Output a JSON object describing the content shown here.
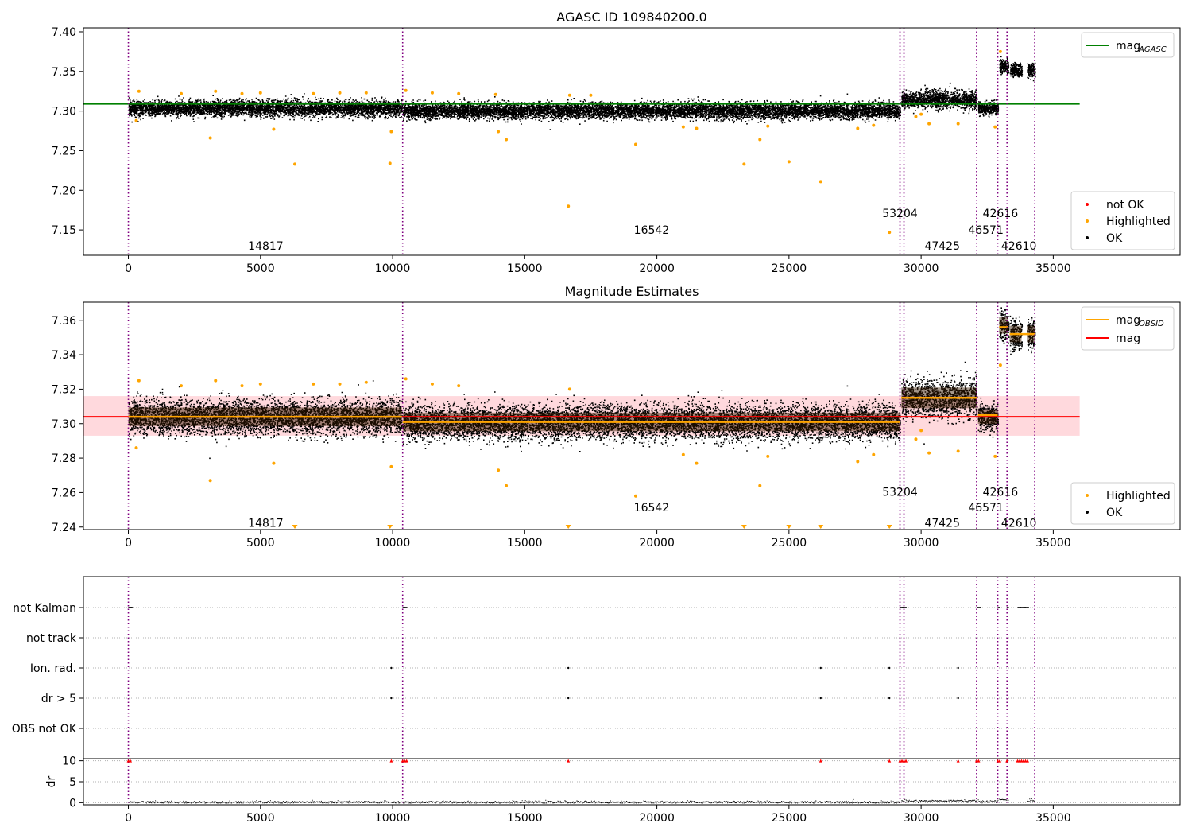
{
  "figure": {
    "panel1": {
      "title": "AGASC ID 109840200.0"
    },
    "panel2": {
      "title": "Magnitude Estimates"
    },
    "panel3": {
      "ylabel_dr": "dr"
    }
  },
  "chart_data": [
    {
      "type": "scatter",
      "panel": "AGASC",
      "title": "AGASC ID 109840200.0",
      "xlim": [
        -1700,
        39800
      ],
      "ylim": [
        7.118,
        7.405
      ],
      "xticks": [
        0,
        5000,
        10000,
        15000,
        20000,
        25000,
        30000,
        35000
      ],
      "yticks": [
        7.15,
        7.2,
        7.25,
        7.3,
        7.35,
        7.4
      ],
      "ytick_labels": [
        "7.15",
        "7.20",
        "7.25",
        "7.30",
        "7.35",
        "7.40"
      ],
      "legend_top": {
        "location": "upper right",
        "entries": [
          {
            "label_main": "mag",
            "label_sub": "AGASC",
            "color": "#008000",
            "kind": "line"
          }
        ]
      },
      "legend_bottom": {
        "location": "lower right",
        "entries": [
          {
            "label": "not OK",
            "color": "#ff0000",
            "kind": "dot"
          },
          {
            "label": "Highlighted",
            "color": "#ffa500",
            "kind": "dot"
          },
          {
            "label": "OK",
            "color": "#000000",
            "kind": "dot"
          }
        ]
      },
      "mag_agasc": {
        "value": 7.309,
        "x_range": [
          -1700,
          36000
        ],
        "color": "#008000"
      },
      "ok_segments": [
        {
          "x0": 0,
          "x1": 10350,
          "center": 7.304,
          "spread": 0.009
        },
        {
          "x0": 10380,
          "x1": 29200,
          "center": 7.301,
          "spread": 0.009
        },
        {
          "x0": 29250,
          "x1": 32100,
          "center": 7.315,
          "spread": 0.01
        },
        {
          "x0": 32150,
          "x1": 32900,
          "center": 7.304,
          "spread": 0.007
        },
        {
          "x0": 32950,
          "x1": 33300,
          "center": 7.357,
          "spread": 0.008
        },
        {
          "x0": 33350,
          "x1": 33800,
          "center": 7.352,
          "spread": 0.008
        },
        {
          "x0": 34000,
          "x1": 34300,
          "center": 7.352,
          "spread": 0.008
        }
      ],
      "highlighted": [
        [
          3100,
          7.266
        ],
        [
          6300,
          7.233
        ],
        [
          5500,
          7.277
        ],
        [
          9900,
          7.234
        ],
        [
          9950,
          7.274
        ],
        [
          14300,
          7.264
        ],
        [
          14000,
          7.274
        ],
        [
          16650,
          7.18
        ],
        [
          19200,
          7.258
        ],
        [
          23300,
          7.233
        ],
        [
          23900,
          7.264
        ],
        [
          25000,
          7.236
        ],
        [
          26200,
          7.211
        ],
        [
          28800,
          7.147
        ],
        [
          30300,
          7.284
        ],
        [
          31400,
          7.284
        ],
        [
          32800,
          7.28
        ],
        [
          33000,
          7.375
        ],
        [
          300,
          7.288
        ],
        [
          400,
          7.325
        ],
        [
          2000,
          7.322
        ],
        [
          3300,
          7.325
        ],
        [
          4300,
          7.322
        ],
        [
          5000,
          7.323
        ],
        [
          7000,
          7.322
        ],
        [
          8000,
          7.323
        ],
        [
          9000,
          7.323
        ],
        [
          10500,
          7.326
        ],
        [
          11500,
          7.323
        ],
        [
          12500,
          7.322
        ],
        [
          13900,
          7.321
        ],
        [
          16700,
          7.32
        ],
        [
          17500,
          7.32
        ],
        [
          21000,
          7.28
        ],
        [
          21500,
          7.278
        ],
        [
          24200,
          7.281
        ],
        [
          27600,
          7.278
        ],
        [
          28200,
          7.282
        ],
        [
          29800,
          7.293
        ],
        [
          30000,
          7.296
        ]
      ],
      "obsid_lines": [
        0,
        10380,
        29200,
        29350,
        32100,
        32900,
        33250,
        34300
      ],
      "obsid_labels": [
        {
          "text": "14817",
          "x": 5200,
          "y": 7.13
        },
        {
          "text": "16542",
          "x": 19800,
          "y": 7.15
        },
        {
          "text": "53204",
          "x": 29200,
          "y": 7.171
        },
        {
          "text": "47425",
          "x": 30800,
          "y": 7.13
        },
        {
          "text": "42616",
          "x": 33000,
          "y": 7.171
        },
        {
          "text": "46571",
          "x": 32450,
          "y": 7.15
        },
        {
          "text": "42610",
          "x": 33700,
          "y": 7.13
        }
      ]
    },
    {
      "type": "scatter",
      "panel": "Magnitude Estimates",
      "title": "Magnitude Estimates",
      "xlim": [
        -1700,
        39800
      ],
      "ylim": [
        7.2385,
        7.3705
      ],
      "xticks": [
        0,
        5000,
        10000,
        15000,
        20000,
        25000,
        30000,
        35000
      ],
      "yticks": [
        7.24,
        7.26,
        7.28,
        7.3,
        7.32,
        7.34,
        7.36
      ],
      "ytick_labels": [
        "7.24",
        "7.26",
        "7.28",
        "7.30",
        "7.32",
        "7.34",
        "7.36"
      ],
      "legend_top": {
        "location": "upper right",
        "entries": [
          {
            "label_main": "mag",
            "label_sub": "OBSID",
            "color": "#ffa500",
            "kind": "line"
          },
          {
            "label_main": "mag",
            "label_sub": "",
            "color": "#ff0000",
            "kind": "line"
          }
        ]
      },
      "legend_bottom": {
        "location": "lower right",
        "entries": [
          {
            "label": "Highlighted",
            "color": "#ffa500",
            "kind": "dot"
          },
          {
            "label": "OK",
            "color": "#000000",
            "kind": "dot"
          }
        ]
      },
      "mag": {
        "value": 7.304,
        "band": [
          7.293,
          7.316
        ],
        "x_range": [
          -1700,
          36000
        ],
        "color": "#ff0000"
      },
      "mag_obsid": [
        {
          "x0": 0,
          "x1": 10350,
          "value": 7.304
        },
        {
          "x0": 10380,
          "x1": 29200,
          "value": 7.301
        },
        {
          "x0": 29250,
          "x1": 32100,
          "value": 7.315
        },
        {
          "x0": 32150,
          "x1": 32900,
          "value": 7.305
        },
        {
          "x0": 32950,
          "x1": 33300,
          "value": 7.356
        },
        {
          "x0": 33350,
          "x1": 34300,
          "value": 7.352
        }
      ],
      "ok_segments": [
        {
          "x0": 0,
          "x1": 10350,
          "center": 7.304,
          "spread": 0.009
        },
        {
          "x0": 10380,
          "x1": 29200,
          "center": 7.301,
          "spread": 0.009
        },
        {
          "x0": 29250,
          "x1": 32100,
          "center": 7.315,
          "spread": 0.01
        },
        {
          "x0": 32150,
          "x1": 32900,
          "center": 7.304,
          "spread": 0.007
        },
        {
          "x0": 32950,
          "x1": 33300,
          "center": 7.357,
          "spread": 0.008
        },
        {
          "x0": 33350,
          "x1": 33800,
          "center": 7.352,
          "spread": 0.008
        },
        {
          "x0": 34000,
          "x1": 34300,
          "center": 7.352,
          "spread": 0.008
        }
      ],
      "highlighted": [
        [
          3100,
          7.267
        ],
        [
          5500,
          7.277
        ],
        [
          9950,
          7.275
        ],
        [
          14000,
          7.273
        ],
        [
          14300,
          7.264
        ],
        [
          19200,
          7.258
        ],
        [
          23900,
          7.264
        ],
        [
          30300,
          7.283
        ],
        [
          31400,
          7.284
        ],
        [
          32800,
          7.281
        ],
        [
          300,
          7.286
        ],
        [
          400,
          7.325
        ],
        [
          2000,
          7.322
        ],
        [
          3300,
          7.325
        ],
        [
          4300,
          7.322
        ],
        [
          5000,
          7.323
        ],
        [
          7000,
          7.323
        ],
        [
          8000,
          7.323
        ],
        [
          9000,
          7.324
        ],
        [
          10500,
          7.326
        ],
        [
          11500,
          7.323
        ],
        [
          12500,
          7.322
        ],
        [
          16700,
          7.32
        ],
        [
          21000,
          7.282
        ],
        [
          21500,
          7.277
        ],
        [
          24200,
          7.281
        ],
        [
          27600,
          7.278
        ],
        [
          28200,
          7.282
        ],
        [
          29800,
          7.291
        ],
        [
          30000,
          7.296
        ],
        [
          33000,
          7.334
        ]
      ],
      "offscale_below": [
        6300,
        9900,
        16650,
        23300,
        25000,
        26200,
        28800
      ],
      "obsid_lines": [
        0,
        10380,
        29200,
        29350,
        32100,
        32900,
        33250,
        34300
      ],
      "obsid_labels": [
        {
          "text": "14817",
          "x": 5200,
          "y": 7.2425
        },
        {
          "text": "16542",
          "x": 19800,
          "y": 7.2515
        },
        {
          "text": "53204",
          "x": 29200,
          "y": 7.2605
        },
        {
          "text": "47425",
          "x": 30800,
          "y": 7.2425
        },
        {
          "text": "42616",
          "x": 33000,
          "y": 7.2605
        },
        {
          "text": "46571",
          "x": 32450,
          "y": 7.2515
        },
        {
          "text": "42610",
          "x": 33700,
          "y": 7.2425
        }
      ]
    },
    {
      "type": "scatter",
      "panel": "flags",
      "xlim": [
        -1700,
        39800
      ],
      "flag_labels": [
        "not Kalman",
        "not track",
        "Ion. rad.",
        "dr > 5",
        "OBS not OK"
      ],
      "flags": {
        "not Kalman": [
          [
            0,
            150
          ],
          [
            10380,
            10550
          ],
          [
            29200,
            29450
          ],
          [
            32100,
            32250
          ],
          [
            32900,
            33000
          ],
          [
            33250,
            33300
          ],
          [
            33650,
            34050
          ]
        ],
        "not track": [],
        "Ion. rad.": [
          9950,
          16650,
          26200,
          28800,
          31400
        ],
        "dr > 5": [
          9950,
          16650,
          26200,
          28800,
          31400
        ],
        "OBS not OK": []
      },
      "obsid_lines": [
        0,
        10380,
        29200,
        29350,
        32100,
        32900,
        33250,
        34300
      ]
    },
    {
      "type": "scatter",
      "panel": "dr",
      "xlim": [
        -1700,
        39800
      ],
      "ylim": [
        -0.5,
        10.5
      ],
      "yticks": [
        0,
        5,
        10
      ],
      "ytick_labels": [
        "0",
        "5",
        "10"
      ],
      "ylabel": "dr",
      "dr_clipped_at_10": [
        [
          0,
          150
        ],
        [
          9950,
          9950
        ],
        [
          10380,
          10550
        ],
        [
          16650,
          16650
        ],
        [
          26200,
          26200
        ],
        [
          28800,
          28800
        ],
        [
          29200,
          29450
        ],
        [
          31400,
          31400
        ],
        [
          32100,
          32250
        ],
        [
          32900,
          33000
        ],
        [
          33250,
          33300
        ],
        [
          33650,
          34050
        ]
      ],
      "dr_baseline_segments": [
        {
          "x0": 0,
          "x1": 29200,
          "level": 0.2
        },
        {
          "x0": 29250,
          "x1": 32100,
          "level": 0.5
        },
        {
          "x0": 32150,
          "x1": 32900,
          "level": 0.4
        },
        {
          "x0": 32950,
          "x1": 33300,
          "level": 0.8
        },
        {
          "x0": 34000,
          "x1": 34300,
          "level": 0.6
        }
      ],
      "obsid_lines": [
        0,
        10380,
        29200,
        29350,
        32100,
        32900,
        33250,
        34300
      ]
    }
  ]
}
